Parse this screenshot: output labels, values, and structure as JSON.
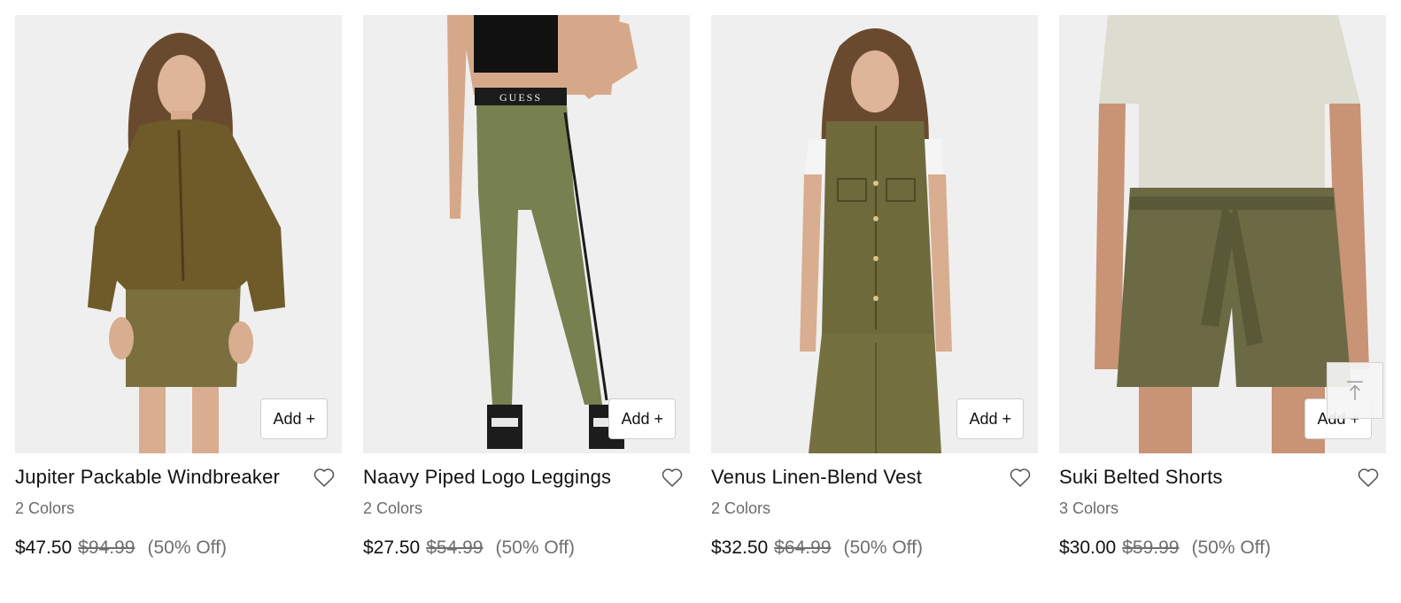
{
  "products": [
    {
      "name": "Jupiter Packable Windbreaker",
      "colors": "2 Colors",
      "price": "$47.50",
      "original_price": "$94.99",
      "discount": "(50% Off)",
      "add_label": "Add +"
    },
    {
      "name": "Naavy Piped Logo Leggings",
      "colors": "2 Colors",
      "price": "$27.50",
      "original_price": "$54.99",
      "discount": "(50% Off)",
      "add_label": "Add +",
      "logo_text": "GUESS"
    },
    {
      "name": "Venus Linen-Blend Vest",
      "colors": "2 Colors",
      "price": "$32.50",
      "original_price": "$64.99",
      "discount": "(50% Off)",
      "add_label": "Add +"
    },
    {
      "name": "Suki Belted Shorts",
      "colors": "3 Colors",
      "price": "$30.00",
      "original_price": "$59.99",
      "discount": "(50% Off)",
      "add_label": "Add +"
    }
  ],
  "icons": {
    "wishlist": "heart-outline-icon",
    "back_to_top": "arrow-up-to-line-icon"
  },
  "colors": {
    "olive": "#6b6a45",
    "page_bg": "#ffffff",
    "muted_text": "#6f6f6f"
  }
}
